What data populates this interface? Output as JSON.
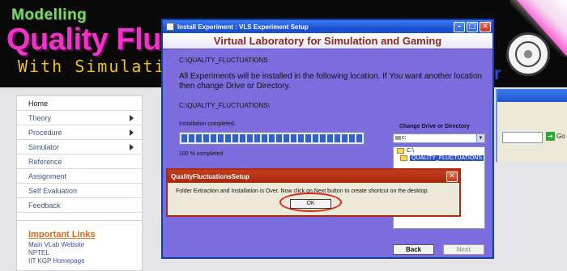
{
  "site": {
    "header": {
      "line1": "Modelling",
      "line2": "Quality Fluc",
      "line3": "With Simulation",
      "partial_text": "r"
    },
    "nav": [
      {
        "label": "Home",
        "has_submenu": false
      },
      {
        "label": "Theory",
        "has_submenu": true
      },
      {
        "label": "Procedure",
        "has_submenu": true
      },
      {
        "label": "Simulator",
        "has_submenu": true
      },
      {
        "label": "Reference",
        "has_submenu": false
      },
      {
        "label": "Assignment",
        "has_submenu": false
      },
      {
        "label": "Self Evaluation",
        "has_submenu": false
      },
      {
        "label": "Feedback",
        "has_submenu": false
      }
    ],
    "important_links": {
      "title": "Important Links",
      "items": [
        "Main VLab Website",
        "NPTEL",
        "IIT KGP Homepage"
      ]
    },
    "background_window": {
      "go_label": "Go"
    }
  },
  "installer": {
    "window_title": "Install Experiment  : VLS Experiment Setup",
    "header": "Virtual Laboratory for Simulation and Gaming",
    "path_top": "C:\\QUALITY_FLUCTUATIONS",
    "message": "All Experiments will be installed in the following location. If You want another location then change Drive or Directory.",
    "path_install": "C:\\QUALITY_FLUCTUATIONS\\",
    "status": "Installation completed.",
    "progress_fraction": 1.0,
    "percent_text": "100 % completed",
    "drive_label": "Change Drive or Directory",
    "drive_value": "c:",
    "directories": [
      {
        "label": "C:\\",
        "selected": false
      },
      {
        "label": "QUALITY_FLUCTUATIONS",
        "selected": true
      }
    ],
    "back_label": "Back",
    "next_label": "Next"
  },
  "dialog": {
    "title": "QualityFluctuationsSetup",
    "message": "Folder Extraction and Installation is Over. Now click on Next button to create shortcut on the desktop.",
    "ok_label": "OK"
  },
  "colors": {
    "installer_bg": "#7d6cde",
    "header_title": "#8a2b1b",
    "annotation_ring": "#e0221a"
  }
}
